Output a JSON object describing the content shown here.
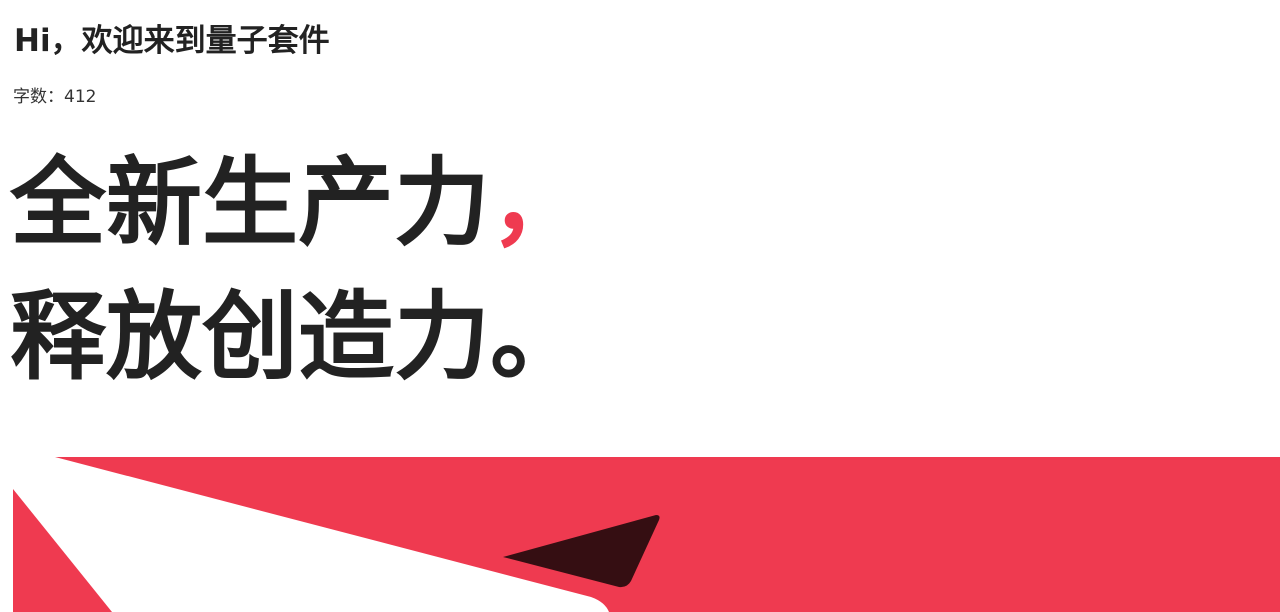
{
  "greeting": {
    "text": "Hi，欢迎来到量子套件"
  },
  "word_count": {
    "text": "字数：412"
  },
  "headline": {
    "line1_text": "全新生产力",
    "line1_punct": "，",
    "line2_text": "释放创造力",
    "line2_punct": "。"
  },
  "colors": {
    "accent": "#ef3a50",
    "text": "#222222",
    "banner_dark": "#350e12",
    "banner_light": "#ffffff"
  }
}
